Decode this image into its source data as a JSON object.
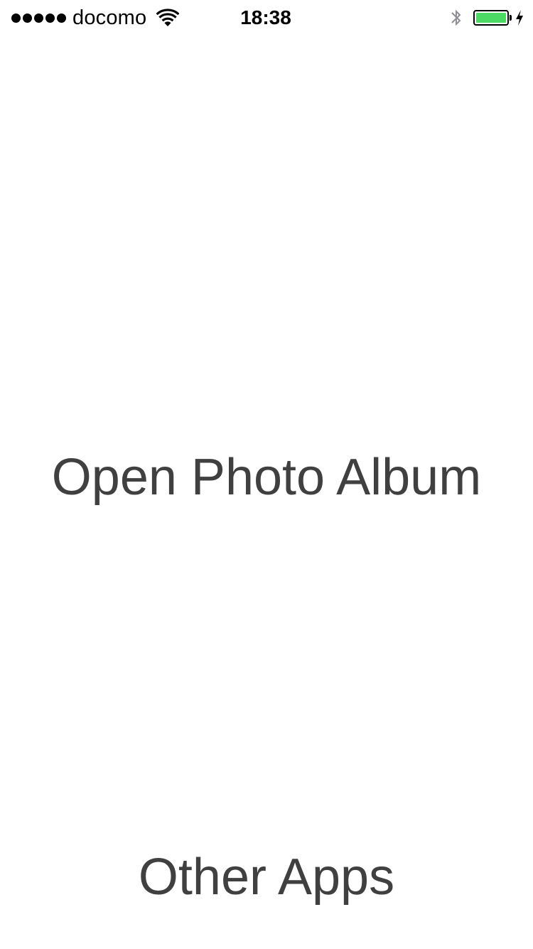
{
  "status_bar": {
    "signal_bars": 5,
    "carrier": "docomo",
    "time": "18:38",
    "battery_level": 1.0,
    "battery_color": "#4cd964",
    "icons": {
      "wifi": "wifi-icon",
      "bluetooth": "bluetooth-icon",
      "battery": "battery-icon",
      "charging": "charging-bolt-icon"
    }
  },
  "main": {
    "open_album_label": "Open Photo Album",
    "other_apps_label": "Other Apps",
    "text_color": "#404040"
  }
}
